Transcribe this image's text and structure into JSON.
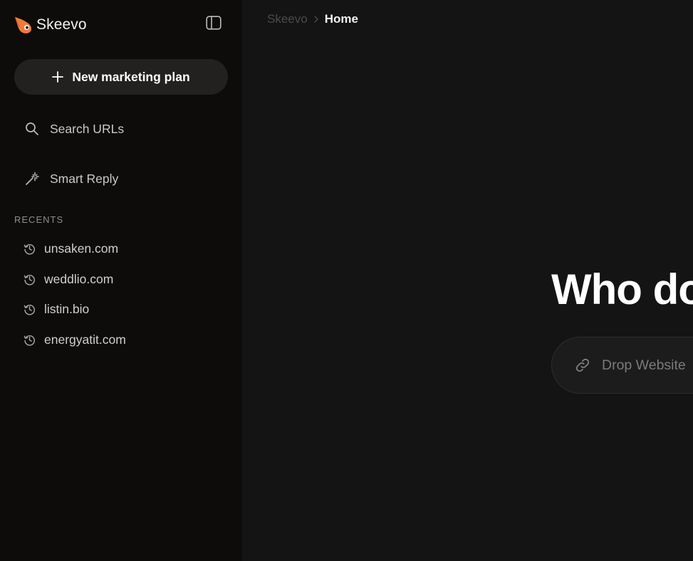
{
  "brand": {
    "name": "Skeevo",
    "logo_icon": "bird-logo-icon",
    "accent_color": "#f07a3a"
  },
  "sidebar": {
    "collapse_icon": "sidebar-toggle-icon",
    "new_plan_label": "New marketing plan",
    "nav": [
      {
        "label": "Search URLs",
        "icon": "search-icon"
      },
      {
        "label": "Smart Reply",
        "icon": "magic-wand-icon"
      }
    ],
    "recents_title": "RECENTS",
    "recents": [
      {
        "label": "unsaken.com",
        "icon": "history-icon"
      },
      {
        "label": "weddlio.com",
        "icon": "history-icon"
      },
      {
        "label": "listin.bio",
        "icon": "history-icon"
      },
      {
        "label": "energyatit.com",
        "icon": "history-icon"
      }
    ]
  },
  "breadcrumb": {
    "root": "Skeevo",
    "current": "Home"
  },
  "main": {
    "hero_title": "Who do",
    "url_input": {
      "placeholder": "Drop Website",
      "value": "",
      "icon": "link-icon"
    }
  }
}
